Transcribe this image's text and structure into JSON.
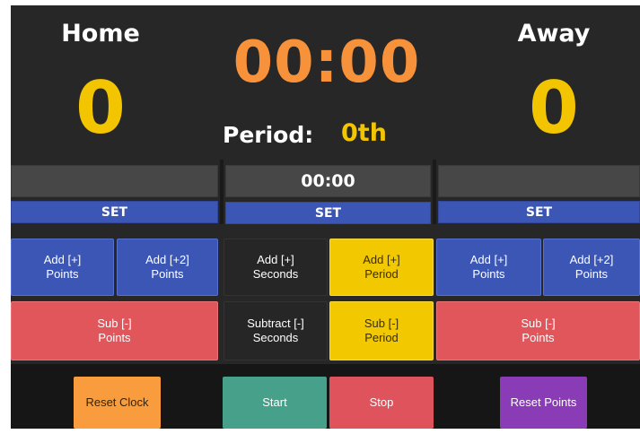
{
  "home": {
    "title": "Home",
    "score": "0",
    "field_value": "",
    "set_label": "SET",
    "add1": "Add [+]\nPoints",
    "add2": "Add [+2]\nPoints",
    "sub": "Sub [-]\nPoints"
  },
  "away": {
    "title": "Away",
    "score": "0",
    "field_value": "",
    "set_label": "SET",
    "add1": "Add [+]\nPoints",
    "add2": "Add [+2]\nPoints",
    "sub": "Sub [-]\nPoints"
  },
  "clock": {
    "display": "00:00",
    "period_label": "Period:",
    "period_value": "0th",
    "field_value": "00:00",
    "set_label": "SET",
    "add_seconds": "Add [+]\nSeconds",
    "add_period": "Add [+]\nPeriod",
    "sub_seconds": "Subtract [-]\nSeconds",
    "sub_period": "Sub [-]\nPeriod"
  },
  "controls": {
    "reset_clock": "Reset Clock",
    "start": "Start",
    "stop": "Stop",
    "reset_points": "Reset Points"
  },
  "colors": {
    "background": "#272727",
    "score": "#f2c500",
    "clock": "#f7923a",
    "blue": "#3c56b5",
    "red": "#e0565b",
    "yellow": "#f2c800",
    "orange": "#f99c3d",
    "green": "#46a08a",
    "purple": "#8a3cb6"
  }
}
